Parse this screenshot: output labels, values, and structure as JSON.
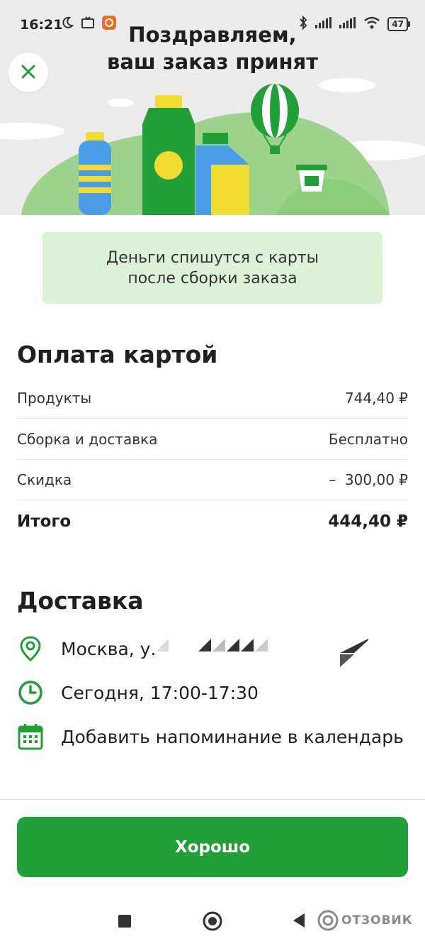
{
  "status_bar": {
    "time": "16:21",
    "battery": "47"
  },
  "hero": {
    "title_line1": "Поздравляем,",
    "title_line2": "ваш заказ принят"
  },
  "notice": {
    "line1": "Деньги спишутся с карты",
    "line2": "после сборки заказа"
  },
  "payment": {
    "title": "Оплата картой",
    "rows": [
      {
        "label": "Продукты",
        "value": "744,40 ₽"
      },
      {
        "label": "Сборка и доставка",
        "value": "Бесплатно"
      },
      {
        "label": "Скидка",
        "value": "–  300,00 ₽"
      }
    ],
    "total": {
      "label": "Итого",
      "value": "444,40 ₽"
    }
  },
  "delivery": {
    "title": "Доставка",
    "address": "Москва, у.",
    "time": "Сегодня, 17:00-17:30",
    "reminder": "Добавить напоминание в календарь"
  },
  "actions": {
    "ok_label": "Хорошо"
  },
  "watermark": {
    "text": "ОТЗОВИК"
  },
  "colors": {
    "accent": "#21a038",
    "notice_bg": "#dcf3d8",
    "hero_bg": "#ececec",
    "hill": "#9ed38e"
  },
  "icons": [
    "moon-icon",
    "tv-icon",
    "app-notification-icon",
    "phone-icon",
    "bluetooth-icon",
    "signal-icon",
    "wifi-icon",
    "battery-icon",
    "close-icon",
    "location-pin-icon",
    "clock-icon",
    "calendar-icon",
    "square-nav-icon",
    "circle-nav-icon",
    "back-nav-icon"
  ]
}
